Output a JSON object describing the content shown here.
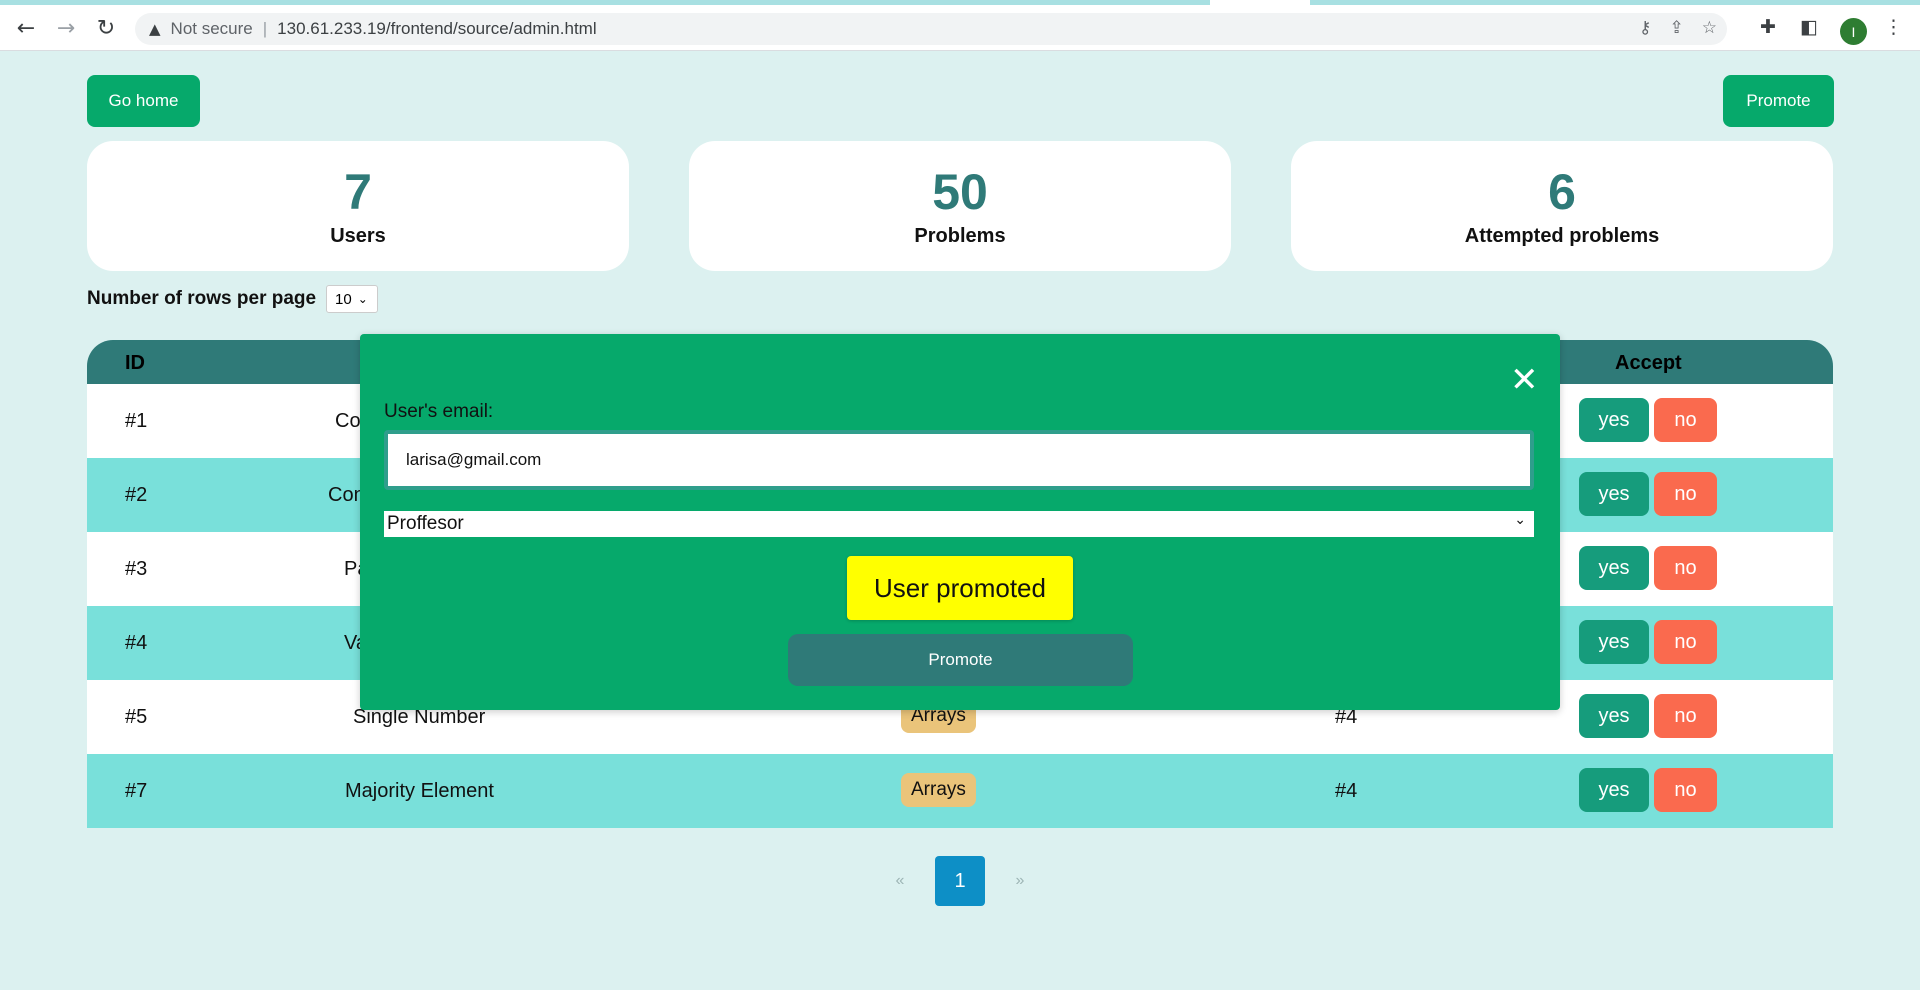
{
  "browser": {
    "not_secure": "Not secure",
    "separator": "|",
    "url": "130.61.233.19/frontend/source/admin.html",
    "profile_initial": "I"
  },
  "header": {
    "go_home": "Go home",
    "promote": "Promote"
  },
  "stats": [
    {
      "value": "7",
      "label": "Users"
    },
    {
      "value": "50",
      "label": "Problems"
    },
    {
      "value": "6",
      "label": "Attempted problems"
    }
  ],
  "rows_per_page": {
    "label": "Number of rows per page",
    "value": "10"
  },
  "table": {
    "headers": {
      "id": "ID",
      "accept": "Accept"
    },
    "rows": [
      {
        "id": "#1",
        "name": "Co",
        "tag": "",
        "author": "",
        "yes": "yes",
        "no": "no"
      },
      {
        "id": "#2",
        "name": "Con",
        "tag": "",
        "author": "",
        "yes": "yes",
        "no": "no"
      },
      {
        "id": "#3",
        "name": "Pa",
        "tag": "",
        "author": "",
        "yes": "yes",
        "no": "no"
      },
      {
        "id": "#4",
        "name": "Va",
        "tag": "",
        "author": "",
        "yes": "yes",
        "no": "no"
      },
      {
        "id": "#5",
        "name": "Single Number",
        "tag": "Arrays",
        "author": "#4",
        "yes": "yes",
        "no": "no"
      },
      {
        "id": "#7",
        "name": "Majority Element",
        "tag": "Arrays",
        "author": "#4",
        "yes": "yes",
        "no": "no"
      }
    ]
  },
  "pagination": {
    "prev": "«",
    "current": "1",
    "next": "»"
  },
  "modal": {
    "email_label": "User's email:",
    "email_value": "larisa@gmail.com",
    "role_value": "Proffesor",
    "toast": "User promoted",
    "promote_button": "Promote",
    "close_symbol": "✕"
  },
  "colors": {
    "accent_green": "#06a96b",
    "dark_teal": "#2f7a78",
    "row_teal": "#79e0da",
    "yes_button": "#169c7c",
    "no_button": "#fa6a4e",
    "tag": "#eac47a",
    "toast": "#ffff00",
    "page_active": "#0d8fc6"
  }
}
